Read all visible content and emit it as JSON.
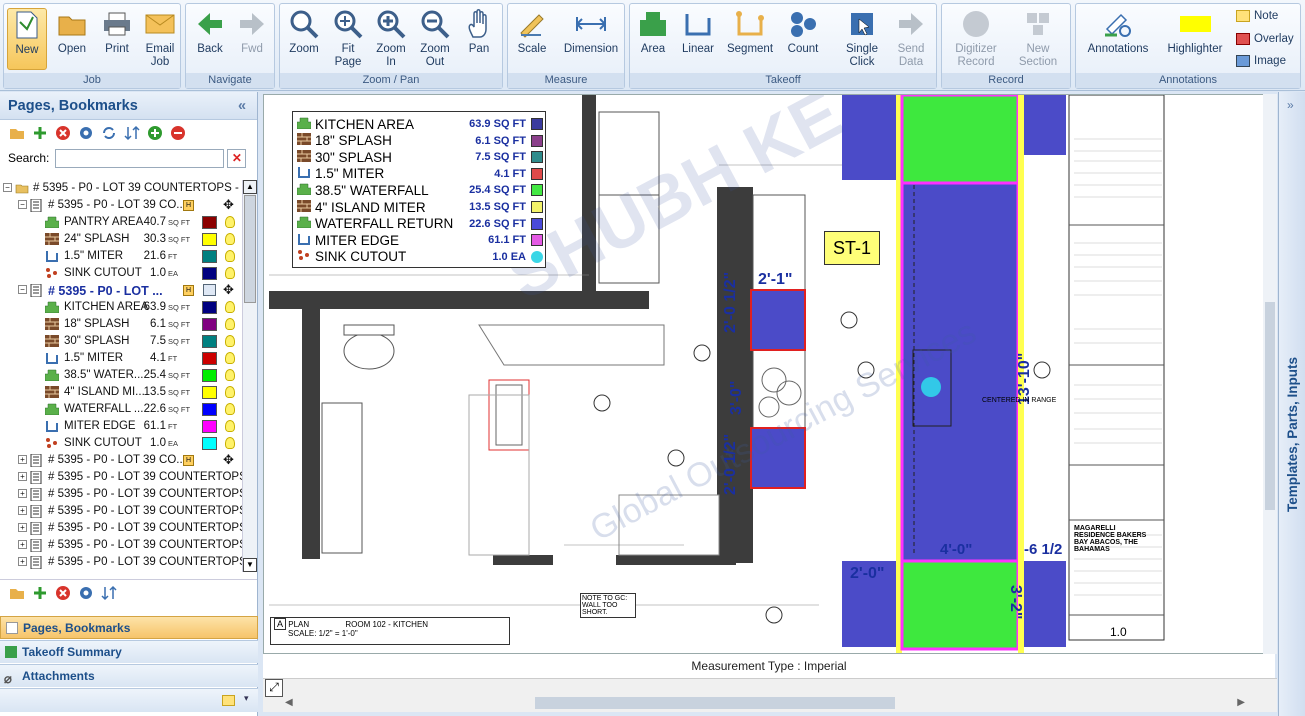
{
  "ribbon": {
    "groups": [
      {
        "label": "Job",
        "buttons": [
          "New",
          "Open",
          "Print",
          "Email Job"
        ]
      },
      {
        "label": "Navigate",
        "buttons": [
          "Back",
          "Fwd"
        ]
      },
      {
        "label": "Zoom / Pan",
        "buttons": [
          "Zoom",
          "Fit Page",
          "Zoom In",
          "Zoom Out",
          "Pan"
        ]
      },
      {
        "label": "Measure",
        "buttons": [
          "Scale",
          "Dimension"
        ]
      },
      {
        "label": "Takeoff",
        "buttons": [
          "Area",
          "Linear",
          "Segment",
          "Count",
          "Single Click",
          "Send Data"
        ]
      },
      {
        "label": "Record",
        "buttons": [
          "Digitizer Record",
          "New Section"
        ]
      },
      {
        "label": "Annotations",
        "buttons": [
          "Annotations",
          "Highlighter",
          "Note",
          "Overlay",
          "Image"
        ]
      }
    ],
    "b": {
      "new": "New",
      "open": "Open",
      "print": "Print",
      "email1": "Email",
      "email2": "Job",
      "back": "Back",
      "fwd": "Fwd",
      "zoom": "Zoom",
      "fit1": "Fit",
      "fit2": "Page",
      "zin1": "Zoom",
      "zin2": "In",
      "zout1": "Zoom",
      "zout2": "Out",
      "pan": "Pan",
      "scale": "Scale",
      "dimension": "Dimension",
      "area": "Area",
      "linear": "Linear",
      "segment": "Segment",
      "count": "Count",
      "single1": "Single",
      "single2": "Click",
      "send1": "Send",
      "send2": "Data",
      "dig1": "Digitizer",
      "dig2": "Record",
      "ns1": "New",
      "ns2": "Section",
      "annotations": "Annotations",
      "highlighter": "Highlighter",
      "note": "Note",
      "overlay": "Overlay",
      "image": "Image"
    },
    "labels": {
      "job": "Job",
      "navigate": "Navigate",
      "zoom": "Zoom / Pan",
      "measure": "Measure",
      "takeoff": "Takeoff",
      "record": "Record",
      "annotations": "Annotations"
    }
  },
  "left": {
    "title": "Pages, Bookmarks",
    "search_label": "Search:",
    "tree": [
      {
        "label": "# 5395 - P0 - LOT 39 COUNTERTOPS - T...",
        "level": 0
      },
      {
        "label": "# 5395 - P0 - LOT 39 CO...",
        "level": 1
      },
      {
        "label": "PANTRY AREA",
        "value": "40.7",
        "unit": "SQ FT",
        "color": "#8b0000",
        "level": 2,
        "kind": "area"
      },
      {
        "label": "24\" SPLASH",
        "value": "30.3",
        "unit": "SQ FT",
        "color": "#ffff00",
        "level": 2,
        "kind": "brick"
      },
      {
        "label": "1.5\" MITER",
        "value": "21.6",
        "unit": "FT",
        "color": "#008080",
        "level": 2,
        "kind": "linear"
      },
      {
        "label": "SINK CUTOUT",
        "value": "1.0",
        "unit": "EA",
        "color": "#000080",
        "level": 2,
        "kind": "count"
      },
      {
        "label": "# 5395 - P0 - LOT ...",
        "level": 1,
        "bold": true
      },
      {
        "label": "KITCHEN AREA",
        "value": "63.9",
        "unit": "SQ FT",
        "color": "#000080",
        "level": 2,
        "kind": "area"
      },
      {
        "label": "18\" SPLASH",
        "value": "6.1",
        "unit": "SQ FT",
        "color": "#800080",
        "level": 2,
        "kind": "brick"
      },
      {
        "label": "30\" SPLASH",
        "value": "7.5",
        "unit": "SQ FT",
        "color": "#008080",
        "level": 2,
        "kind": "brick"
      },
      {
        "label": "1.5\" MITER",
        "value": "4.1",
        "unit": "FT",
        "color": "#cc0000",
        "level": 2,
        "kind": "linear"
      },
      {
        "label": "38.5\" WATER...",
        "value": "25.4",
        "unit": "SQ FT",
        "color": "#00ee00",
        "level": 2,
        "kind": "area"
      },
      {
        "label": "4\" ISLAND MI...",
        "value": "13.5",
        "unit": "SQ FT",
        "color": "#ffff00",
        "level": 2,
        "kind": "brick"
      },
      {
        "label": "WATERFALL ...",
        "value": "22.6",
        "unit": "SQ FT",
        "color": "#0000ff",
        "level": 2,
        "kind": "area"
      },
      {
        "label": "MITER EDGE",
        "value": "61.1",
        "unit": "FT",
        "color": "#ff00ff",
        "level": 2,
        "kind": "linear"
      },
      {
        "label": "SINK CUTOUT",
        "value": "1.0",
        "unit": "EA",
        "color": "#00ffff",
        "level": 2,
        "kind": "count"
      },
      {
        "label": "# 5395 - P0 - LOT 39 CO...",
        "level": 1
      },
      {
        "label": "# 5395 - P0 - LOT 39 COUNTERTOPS",
        "level": 1
      },
      {
        "label": "# 5395 - P0 - LOT 39 COUNTERTOPS",
        "level": 1
      },
      {
        "label": "# 5395 - P0 - LOT 39 COUNTERTOPS",
        "level": 1
      },
      {
        "label": "# 5395 - P0 - LOT 39 COUNTERTOPS",
        "level": 1
      },
      {
        "label": "# 5395 - P0 - LOT 39 COUNTERTOPS",
        "level": 1
      },
      {
        "label": "# 5395 - P0 - LOT 39 COUNTERTOPS",
        "level": 1
      }
    ],
    "nav": {
      "pages": "Pages, Bookmarks",
      "takeoff": "Takeoff Summary",
      "attachments": "Attachments"
    }
  },
  "legend": [
    {
      "label": "KITCHEN AREA",
      "value": "63.9 SQ FT",
      "color": "#3b3b9e",
      "kind": "area"
    },
    {
      "label": "18\" SPLASH",
      "value": "6.1 SQ FT",
      "color": "#8b3f8b",
      "kind": "brick"
    },
    {
      "label": "30\" SPLASH",
      "value": "7.5 SQ FT",
      "color": "#2f8c8c",
      "kind": "brick"
    },
    {
      "label": "1.5\" MITER",
      "value": "4.1 FT",
      "color": "#e04a4a",
      "kind": "linear"
    },
    {
      "label": "38.5\" WATERFALL",
      "value": "25.4 SQ FT",
      "color": "#43e843",
      "kind": "area"
    },
    {
      "label": "4\" ISLAND MITER",
      "value": "13.5 SQ FT",
      "color": "#f3f36a",
      "kind": "brick"
    },
    {
      "label": "WATERFALL RETURN",
      "value": "22.6 SQ FT",
      "color": "#4a4ad9",
      "kind": "area"
    },
    {
      "label": "MITER EDGE",
      "value": "61.1 FT",
      "color": "#e45ae4",
      "kind": "linear"
    },
    {
      "label": "SINK CUTOUT",
      "value": "1.0 EA",
      "color": "#3ad6e6",
      "kind": "count"
    }
  ],
  "drawing": {
    "st1": "ST-1",
    "d1": "2'-1\"",
    "d2": "2'-0 1/2\"",
    "d3": "3'-0\"",
    "d4": "2'-0 1/2\"",
    "d5": "13'-10\"",
    "d6": "4'-0\"",
    "d7": "2'-0\"",
    "d8": "3'-2\"",
    "d9": "-6 1/2",
    "centered": "CENTERED IN RANGE",
    "note": "NOTE TO GC: WALL TOO SHORT.",
    "plan": "PLAN",
    "room": "ROOM 102 - KITCHEN",
    "scale_txt": "SCALE: 1/2\" = 1'-0\"",
    "watermark": "Global Outsourcing Services",
    "title_block": "MAGARELLI RESIDENCE BAKERS BAY ABACOS, THE BAHAMAS",
    "sheet": "1.0"
  },
  "status": "Measurement Type : Imperial",
  "right_panel": "Templates, Parts, Inputs"
}
